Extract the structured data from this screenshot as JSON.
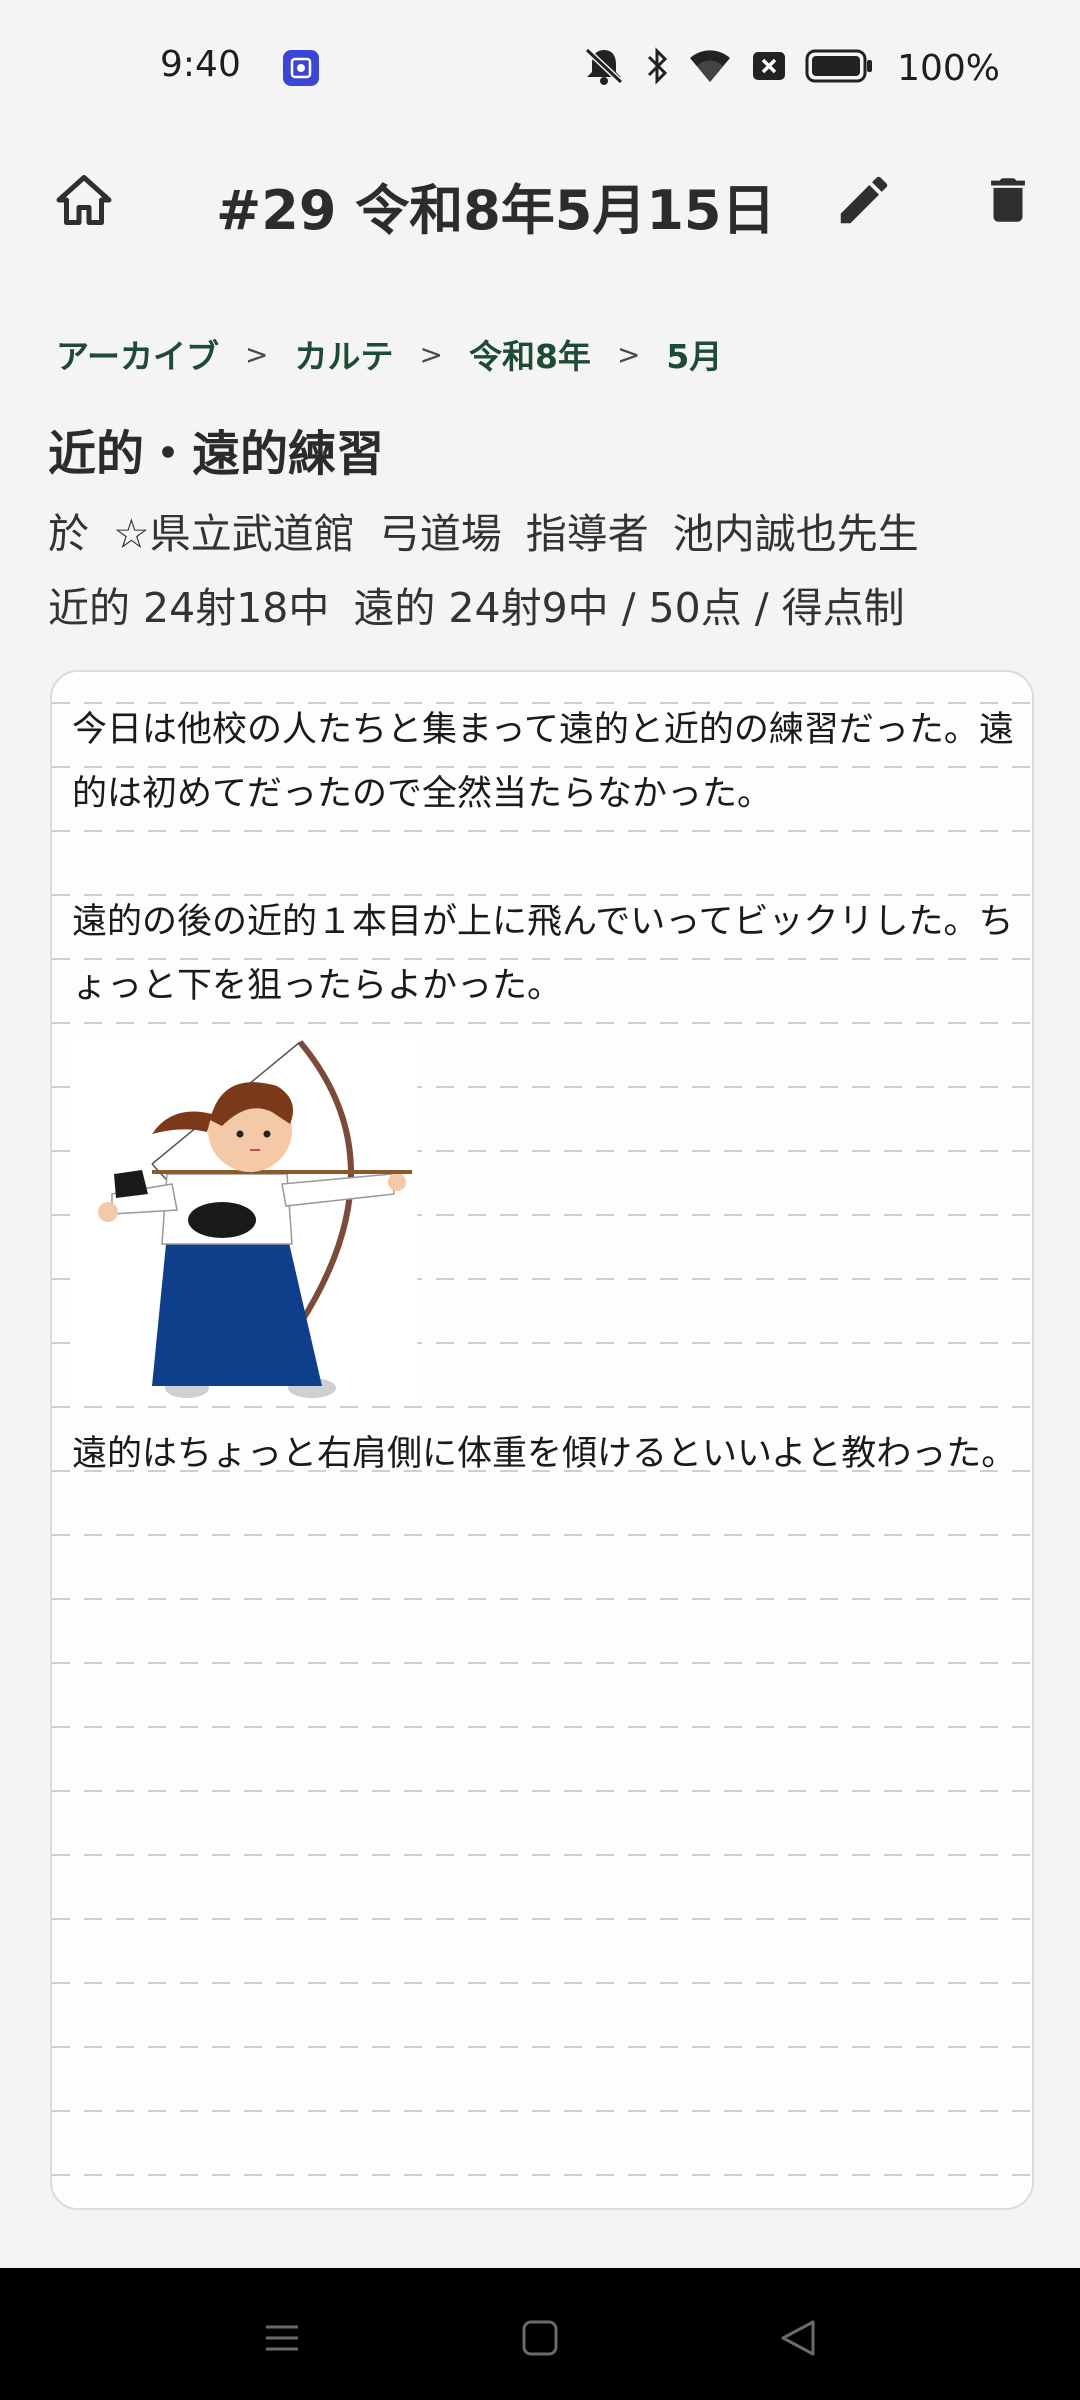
{
  "status_bar": {
    "time": "9:40",
    "battery": "100%",
    "icons": [
      "screenshot-app-icon",
      "mute-icon",
      "bluetooth-icon",
      "wifi-icon",
      "sim-off-icon",
      "battery-icon"
    ]
  },
  "app_bar": {
    "title": "#29 令和8年5月15日",
    "icons": [
      "home-icon",
      "edit-icon",
      "delete-icon"
    ]
  },
  "breadcrumb": {
    "items": [
      "アーカイブ",
      "カルテ",
      "令和8年",
      "5月"
    ],
    "separator": ">"
  },
  "entry": {
    "heading": "近的・遠的練習",
    "location_prefix": "於",
    "location": "☆県立武道館",
    "venue": "弓道場",
    "instructor_label": "指導者",
    "instructor": "池内誠也先生",
    "near_score": "近的 24射18中",
    "far_score": "遠的 24射9中 / 50点 / 得点制"
  },
  "note": {
    "paragraph1": "今日は他校の人たちと集まって遠的と近的の練習だった。遠的は初めてだったので全然当たらなかった。",
    "paragraph2": "遠的の後の近的１本目が上に飛んでいってビックリした。ちょっと下を狙ったらよかった。",
    "paragraph3": "遠的はちょっと右肩側に体重を傾けるといいよと教わった。"
  },
  "colors": {
    "breadcrumb": "#1e4a36",
    "background": "#f4f4f4",
    "hakama": "#0f3f8a",
    "nav_bar": "#000000"
  }
}
